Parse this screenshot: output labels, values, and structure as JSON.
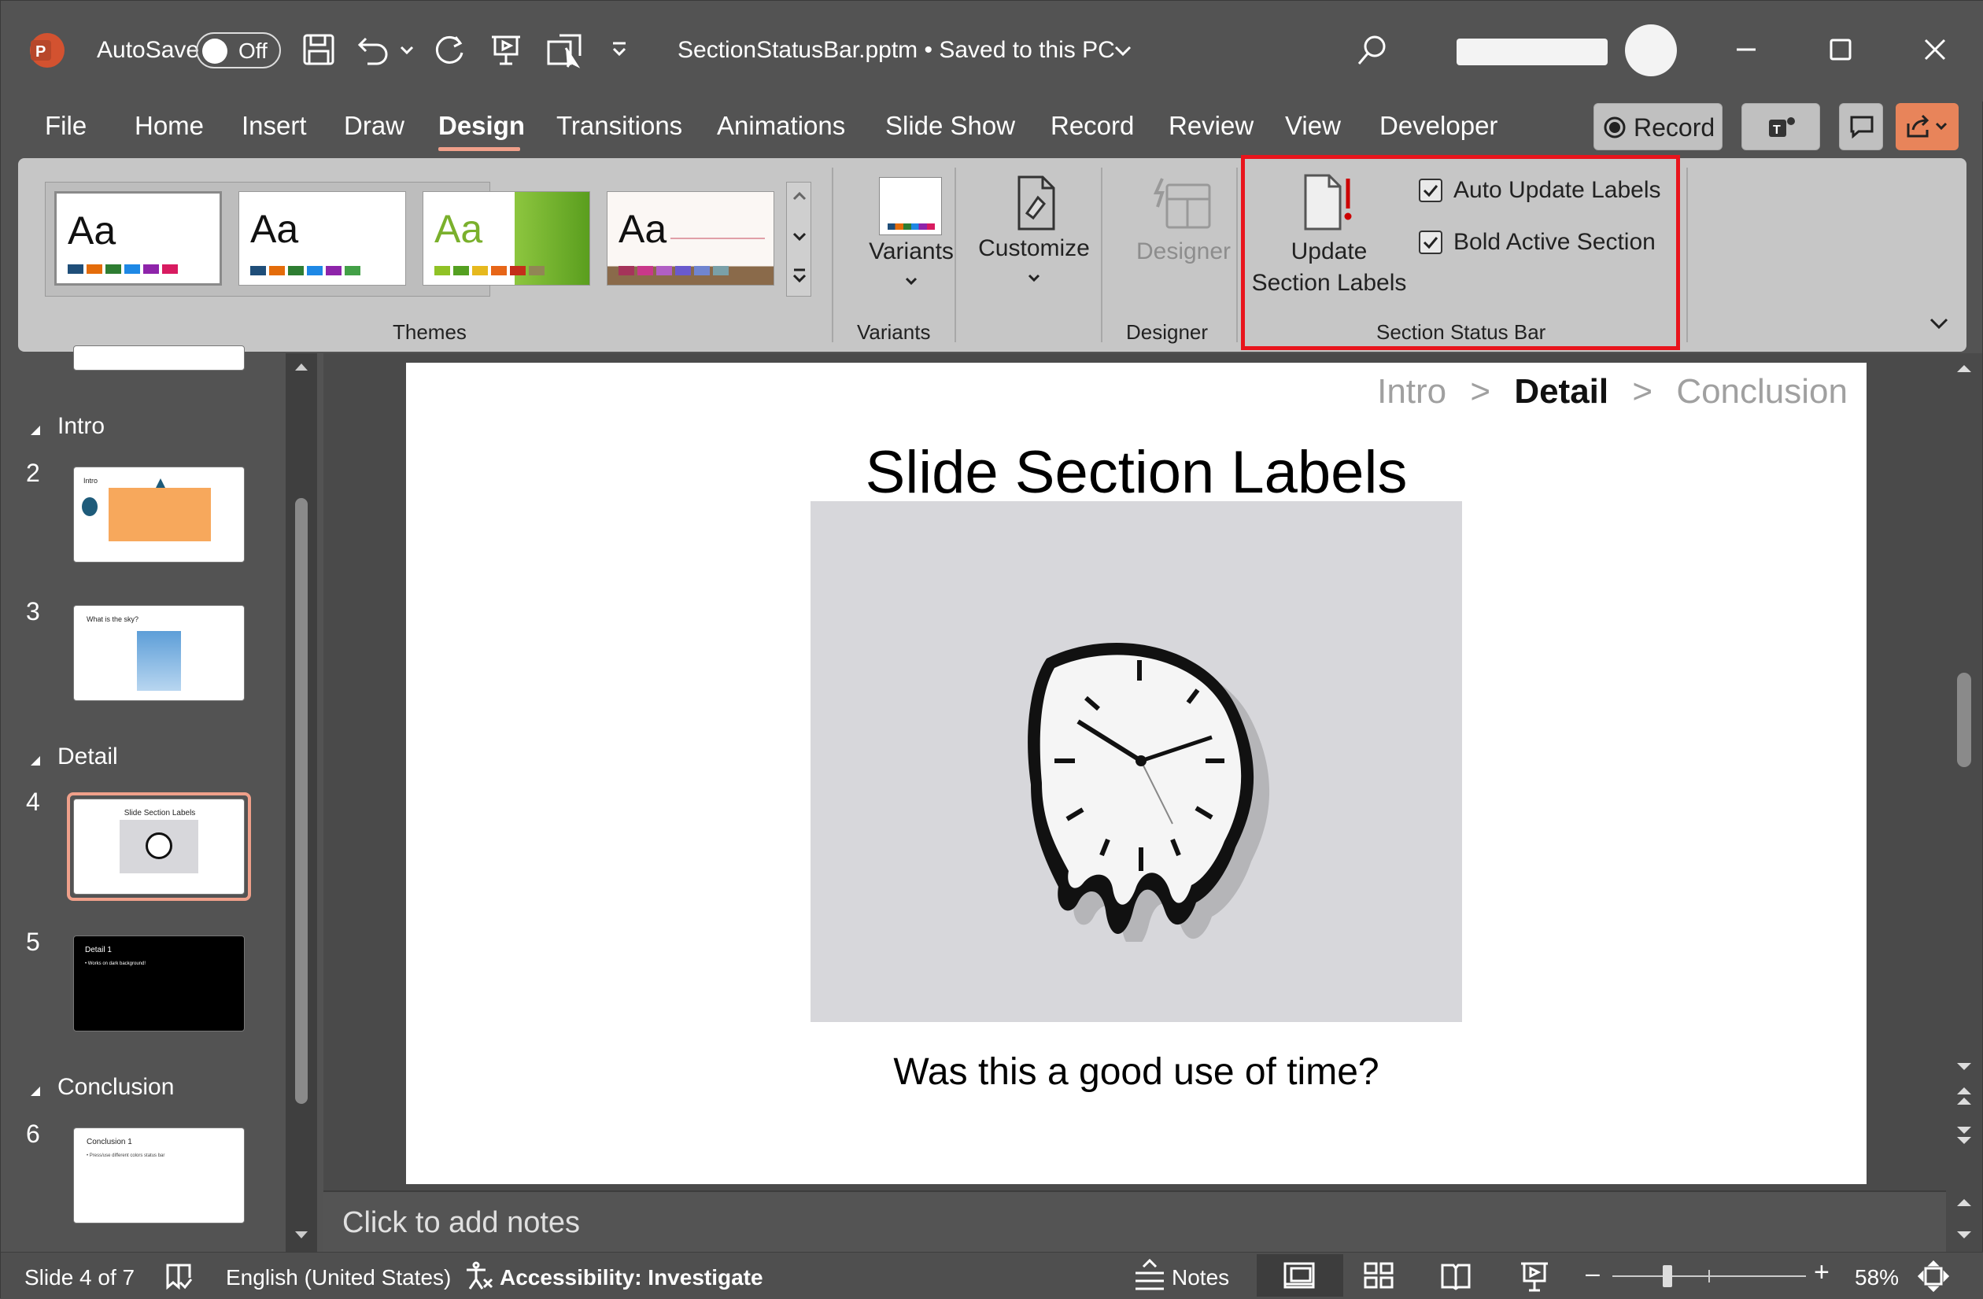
{
  "titlebar": {
    "app_icon": "powerpoint-icon",
    "autosave_label": "AutoSave",
    "autosave_state": "Off",
    "document_title": "SectionStatusBar.pptm • Saved to this PC",
    "search_icon": "search-icon"
  },
  "tabs": [
    "File",
    "Home",
    "Insert",
    "Draw",
    "Design",
    "Transitions",
    "Animations",
    "Slide Show",
    "Record",
    "Review",
    "View",
    "Developer"
  ],
  "active_tab": "Design",
  "top_right": {
    "record_label": "Record"
  },
  "ribbon": {
    "themes_label": "Themes",
    "theme_text": "Aa",
    "variants_label": "Variants",
    "variants_group_label": "Variants",
    "customize_label": "Customize",
    "designer_label": "Designer",
    "designer_group_label": "Designer",
    "update_line1": "Update",
    "update_line2": "Section Labels",
    "auto_update_label": "Auto Update Labels",
    "bold_active_label": "Bold Active Section",
    "section_status_group_label": "Section Status Bar",
    "highlight_color": "#e8141c"
  },
  "thumbs": {
    "sections": [
      "Intro",
      "Detail",
      "Conclusion"
    ],
    "slides": [
      {
        "num": "2",
        "text": "Intro"
      },
      {
        "num": "3",
        "text": "What is the sky?"
      },
      {
        "num": "4",
        "text": "Slide Section Labels"
      },
      {
        "num": "5",
        "text": "Detail 1",
        "sub": "• Works on dark background!"
      },
      {
        "num": "6",
        "text": "Conclusion 1",
        "sub": "• Press/use different colors status bar"
      }
    ]
  },
  "slide": {
    "crumb_intro": "Intro",
    "crumb_sep": ">",
    "crumb_detail": "Detail",
    "crumb_conclusion": "Conclusion",
    "title": "Slide Section Labels",
    "caption": "Was this a good use of time?"
  },
  "notes_placeholder": "Click to add notes",
  "status": {
    "slide_count": "Slide 4 of 7",
    "language": "English (United States)",
    "accessibility": "Accessibility: Investigate",
    "notes": "Notes",
    "zoom": "58%"
  }
}
